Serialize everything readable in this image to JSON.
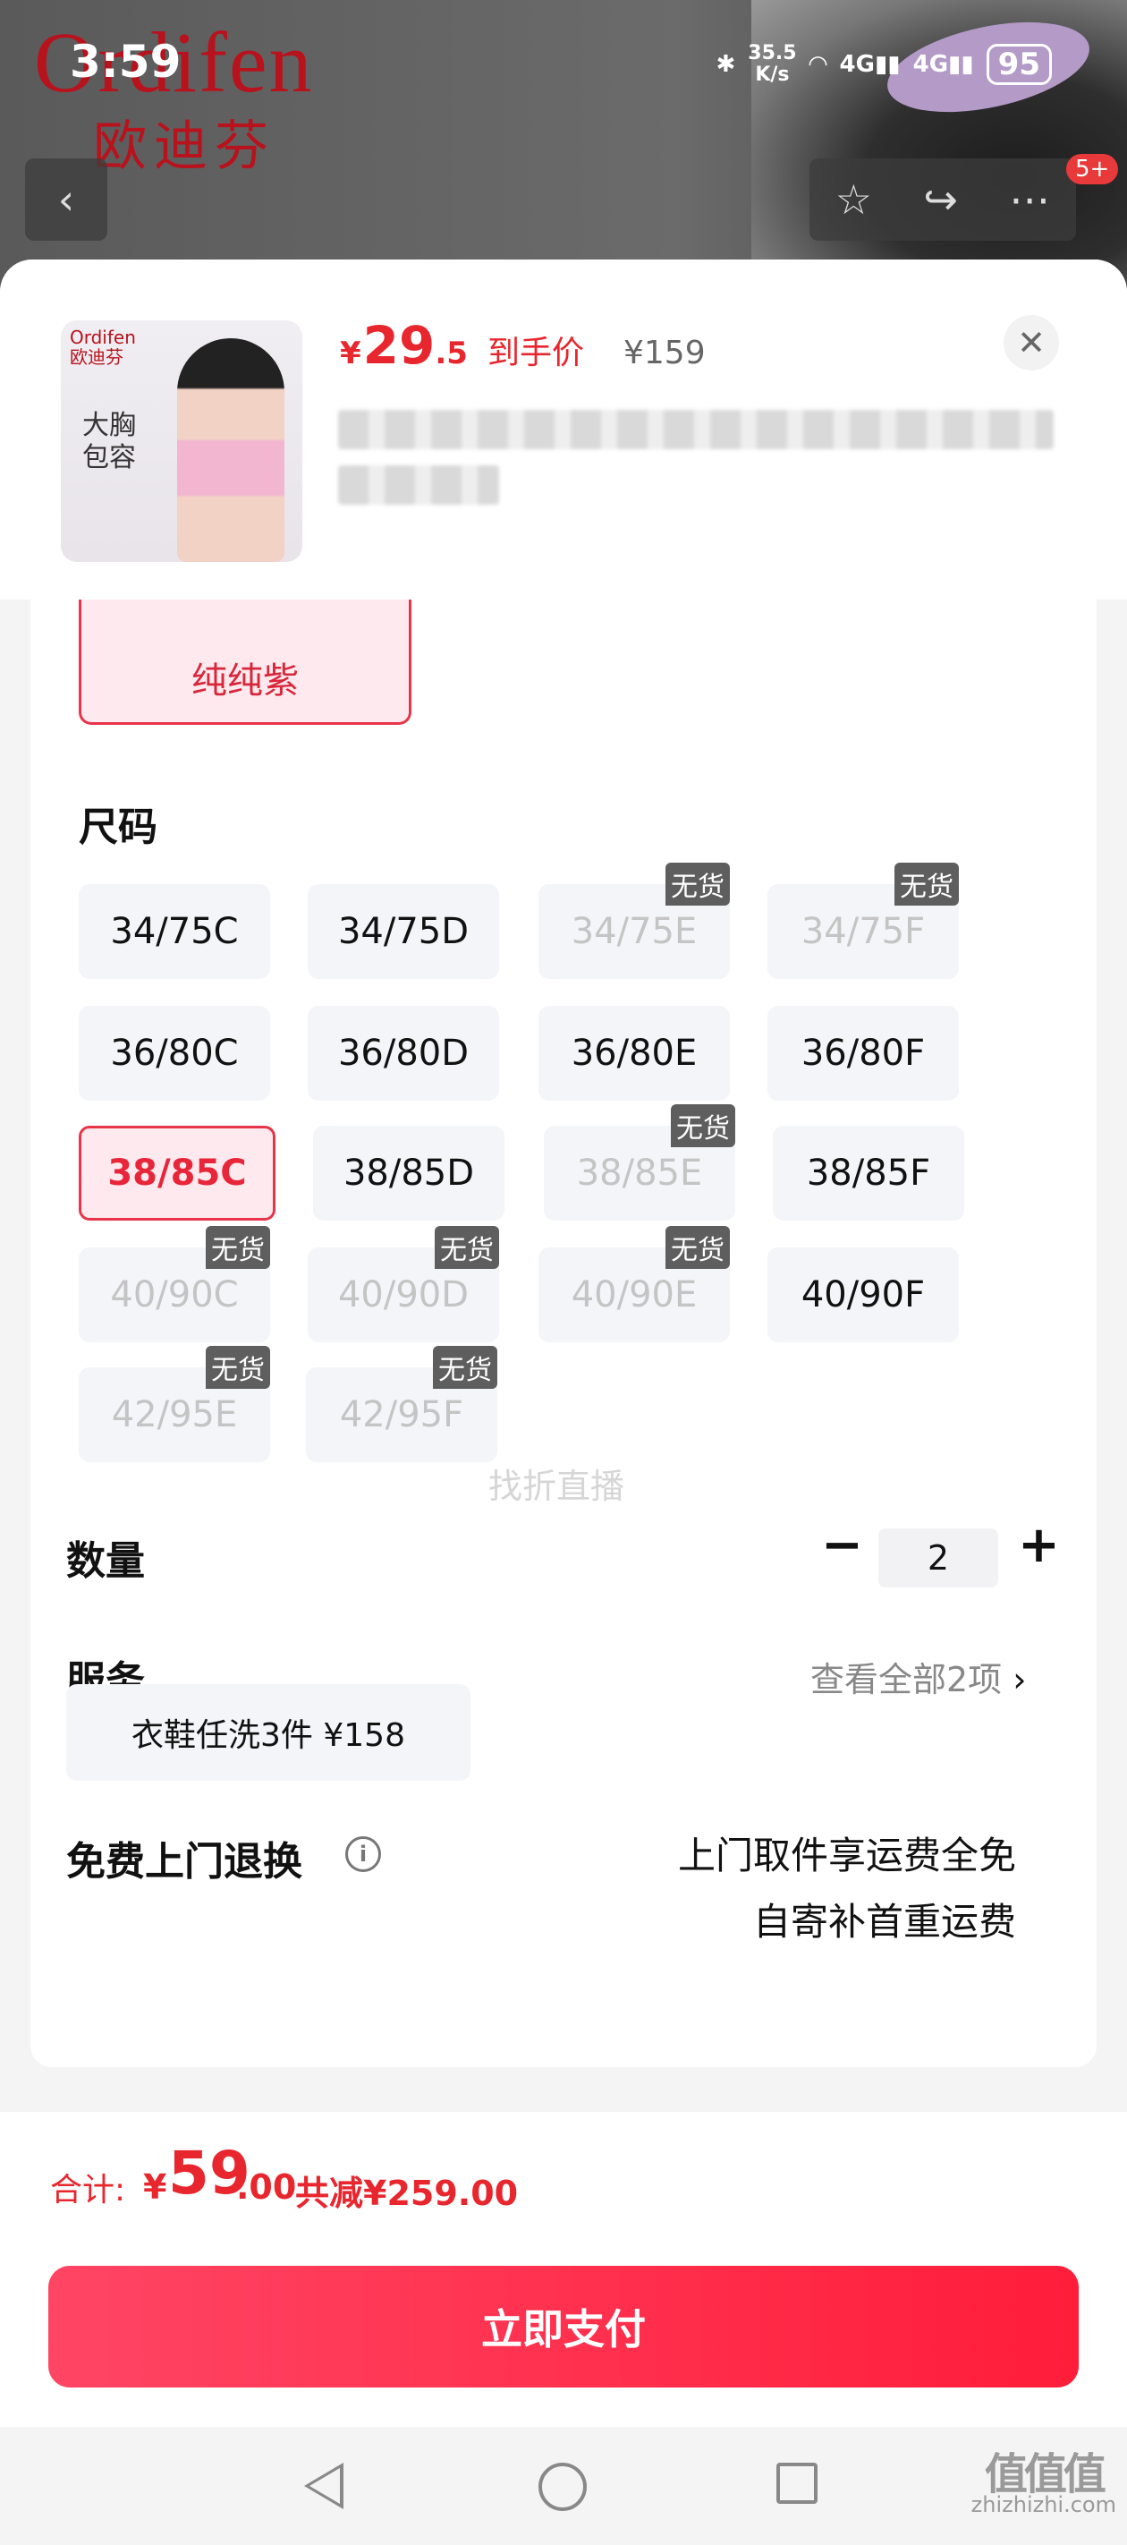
{
  "status_bar": {
    "time": "3:59",
    "speed_value": "35.5",
    "speed_unit": "K/s",
    "network_a": "4G",
    "network_b": "4G",
    "battery": "95"
  },
  "background": {
    "brand_en": "Ordifen",
    "brand_cn": "欧迪芬",
    "badge": "5+"
  },
  "product": {
    "thumb_brand": "Ordifen",
    "thumb_brand_cn": "欧迪芬",
    "thumb_slogan_1": "大胸",
    "thumb_slogan_2": "包容",
    "price_currency": "¥",
    "price_int": "29",
    "price_dec": ".5",
    "price_tag": "到手价",
    "price_original": "¥159",
    "close_glyph": "✕"
  },
  "color_selected": "纯纯紫",
  "size_section": {
    "title": "尺码",
    "na_label": "无货",
    "sizes": [
      {
        "label": "34/75C"
      },
      {
        "label": "34/75D"
      },
      {
        "label": "34/75E"
      },
      {
        "label": "34/75F"
      },
      {
        "label": "36/80C"
      },
      {
        "label": "36/80D"
      },
      {
        "label": "36/80E"
      },
      {
        "label": "36/80F"
      },
      {
        "label": "38/85C"
      },
      {
        "label": "38/85D"
      },
      {
        "label": "38/85E"
      },
      {
        "label": "38/85F"
      },
      {
        "label": "40/90C"
      },
      {
        "label": "40/90D"
      },
      {
        "label": "40/90E"
      },
      {
        "label": "40/90F"
      },
      {
        "label": "42/95E"
      },
      {
        "label": "42/95F"
      }
    ]
  },
  "watermark": "找折直播",
  "quantity": {
    "title": "数量",
    "minus": "−",
    "value": "2",
    "plus": "+"
  },
  "service": {
    "title": "服务",
    "more": "查看全部2项",
    "more_chevron": "›",
    "chip": "衣鞋任洗3件  ¥158"
  },
  "returns": {
    "title": "免费上门退换",
    "info_glyph": "i",
    "line1": "上门取件享运费全免",
    "line2": "自寄补首重运费"
  },
  "total": {
    "label": "合计:",
    "currency": "¥",
    "int": "59",
    "dec": ".00",
    "save": "共减¥259.00"
  },
  "pay_button": "立即支付",
  "corner_watermark": {
    "glyph": "值值值",
    "site": "zhizhizhi.com"
  }
}
